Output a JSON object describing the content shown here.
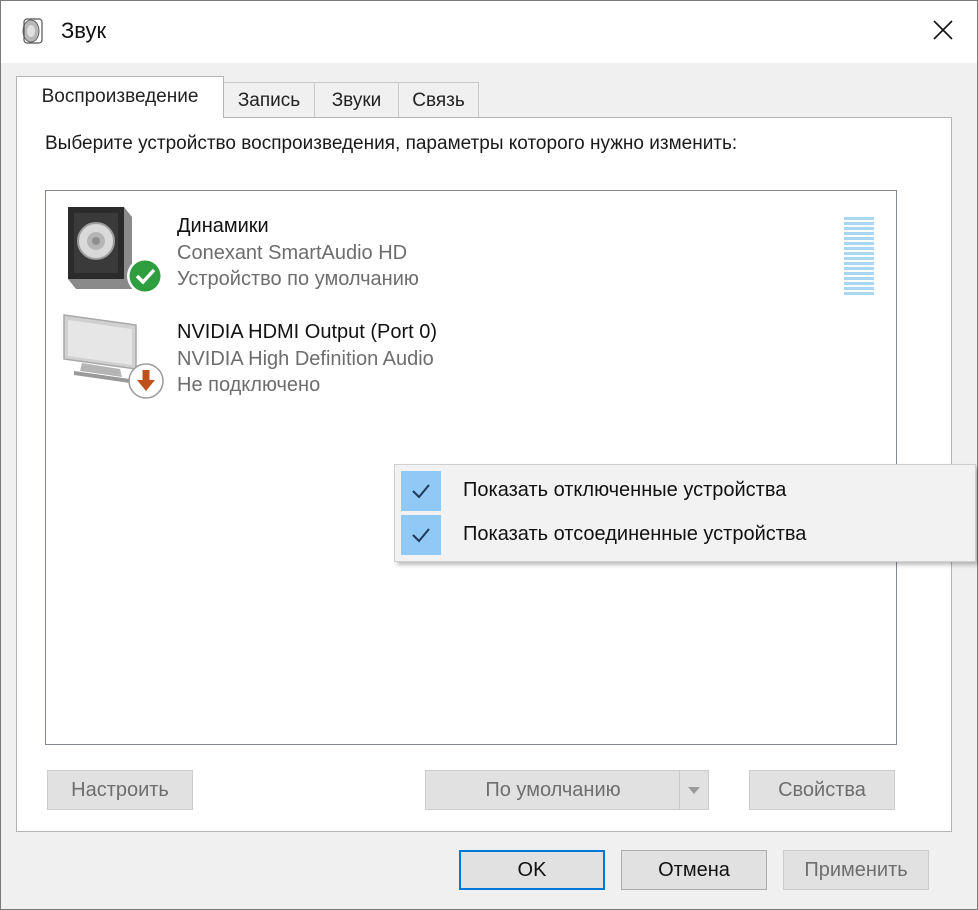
{
  "window": {
    "title": "Звук"
  },
  "tabs": [
    {
      "label": "Воспроизведение",
      "active": true
    },
    {
      "label": "Запись",
      "active": false
    },
    {
      "label": "Звуки",
      "active": false
    },
    {
      "label": "Связь",
      "active": false
    }
  ],
  "panel": {
    "instruction": "Выберите устройство воспроизведения, параметры которого нужно изменить:"
  },
  "devices": [
    {
      "name": "Динамики",
      "driver": "Conexant SmartAudio HD",
      "status": "Устройство по умолчанию",
      "icon": "speaker-icon",
      "badge": "default-check-badge-icon",
      "badge_color": "#2e9e3e"
    },
    {
      "name": "NVIDIA HDMI Output (Port 0)",
      "driver": "NVIDIA High Definition Audio",
      "status": "Не подключено",
      "icon": "monitor-icon",
      "badge": "disconnected-arrow-badge-icon",
      "badge_color": "#c0501a"
    }
  ],
  "context_menu": {
    "items": [
      {
        "label": "Показать отключенные устройства",
        "checked": true
      },
      {
        "label": "Показать отсоединенные устройства",
        "checked": true
      }
    ]
  },
  "panel_buttons": {
    "configure": "Настроить",
    "set_default": "По умолчанию",
    "properties": "Свойства"
  },
  "dialog_buttons": {
    "ok": "OK",
    "cancel": "Отмена",
    "apply": "Применить"
  },
  "colors": {
    "accent": "#0078d7",
    "menu_check_bg": "#90c8f6",
    "level_meter": "#a9d6f0"
  }
}
